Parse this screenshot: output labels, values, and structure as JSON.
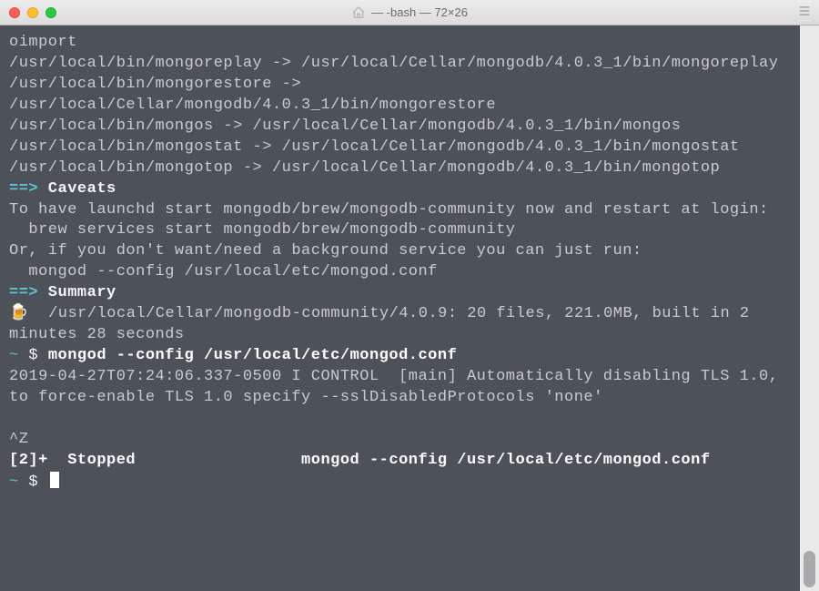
{
  "titlebar": {
    "title": "— -bash — 72×26",
    "home_icon": "home-icon",
    "menu_icon": "menu-icon"
  },
  "terminal": {
    "lines": {
      "l1": "oimport",
      "l2": "/usr/local/bin/mongoreplay -> /usr/local/Cellar/mongodb/4.0.3_1/bin/mongoreplay",
      "l3": "/usr/local/bin/mongorestore -> /usr/local/Cellar/mongodb/4.0.3_1/bin/mongorestore",
      "l4": "/usr/local/bin/mongos -> /usr/local/Cellar/mongodb/4.0.3_1/bin/mongos",
      "l5": "/usr/local/bin/mongostat -> /usr/local/Cellar/mongodb/4.0.3_1/bin/mongostat",
      "l6": "/usr/local/bin/mongotop -> /usr/local/Cellar/mongodb/4.0.3_1/bin/mongotop"
    },
    "caveats_arrow": "==>",
    "caveats_label": " Caveats",
    "caveats_body1": "To have launchd start mongodb/brew/mongodb-community now and restart at login:",
    "caveats_body2": "  brew services start mongodb/brew/mongodb-community",
    "caveats_body3": "Or, if you don't want/need a background service you can just run:",
    "caveats_body4": "  mongod --config /usr/local/etc/mongod.conf",
    "summary_arrow": "==>",
    "summary_label": " Summary",
    "beer": "🍺",
    "summary_body": "  /usr/local/Cellar/mongodb-community/4.0.9: 20 files, 221.0MB, built in 2 minutes 28 seconds",
    "prompt_tilde": "~",
    "prompt_dollar": " $ ",
    "user_cmd": "mongod --config /usr/local/etc/mongod.conf",
    "log_line": "2019-04-27T07:24:06.337-0500 I CONTROL  [main] Automatically disabling TLS 1.0, to force-enable TLS 1.0 specify --sslDisabledProtocols 'none'",
    "ctrlz": "^Z",
    "stopped": "[2]+  Stopped                 mongod --config /usr/local/etc/mongod.conf"
  }
}
